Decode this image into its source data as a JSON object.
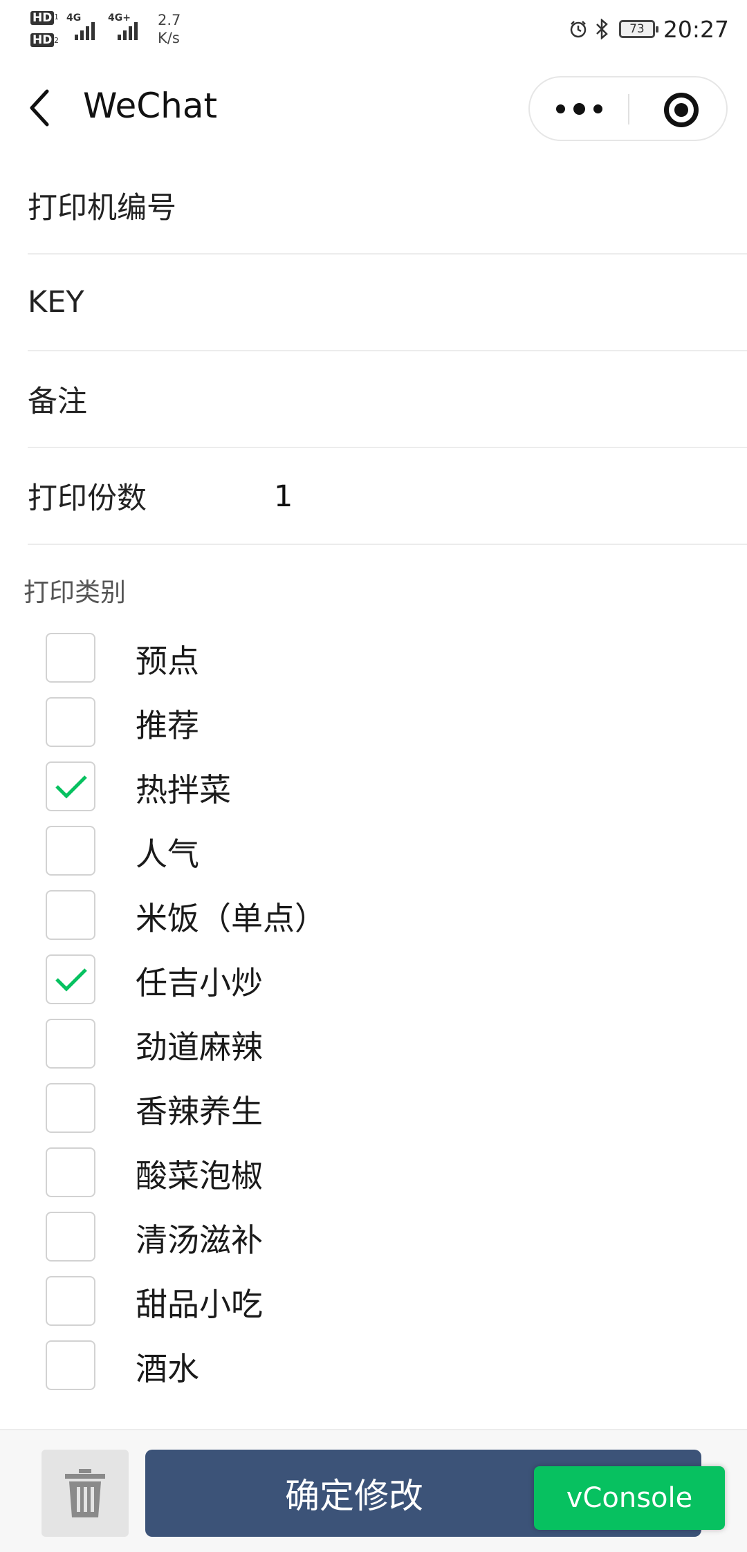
{
  "status_bar": {
    "sim1": "HD",
    "sim1_index": "1",
    "sim2": "HD",
    "sim2_index": "2",
    "net1": "4G",
    "net2": "4G+",
    "speed_value": "2.7",
    "speed_unit": "K/s",
    "battery": "73",
    "time": "20:27"
  },
  "nav": {
    "title": "WeChat",
    "icons": [
      "back-chevron",
      "more-dots",
      "close-target"
    ]
  },
  "form": {
    "printer_id_label": "打印机编号",
    "printer_id_value": "",
    "key_label": "KEY",
    "key_value": "",
    "remark_label": "备注",
    "remark_value": "",
    "copies_label": "打印份数",
    "copies_value": "1"
  },
  "categories": {
    "title": "打印类别",
    "items": [
      {
        "label": "预点",
        "checked": false
      },
      {
        "label": "推荐",
        "checked": false
      },
      {
        "label": "热拌菜",
        "checked": true
      },
      {
        "label": "人气",
        "checked": false
      },
      {
        "label": "米饭（单点）",
        "checked": false
      },
      {
        "label": "任吉小炒",
        "checked": true
      },
      {
        "label": "劲道麻辣",
        "checked": false
      },
      {
        "label": "香辣养生",
        "checked": false
      },
      {
        "label": "酸菜泡椒",
        "checked": false
      },
      {
        "label": "清汤滋补",
        "checked": false
      },
      {
        "label": "甜品小吃",
        "checked": false
      },
      {
        "label": "酒水",
        "checked": false
      }
    ]
  },
  "bottom": {
    "confirm_label": "确定修改",
    "trash_icon": "trash-icon"
  },
  "vconsole_label": "vConsole",
  "colors": {
    "primary_button": "#3c5378",
    "check": "#07c160",
    "vconsole": "#07c160"
  }
}
